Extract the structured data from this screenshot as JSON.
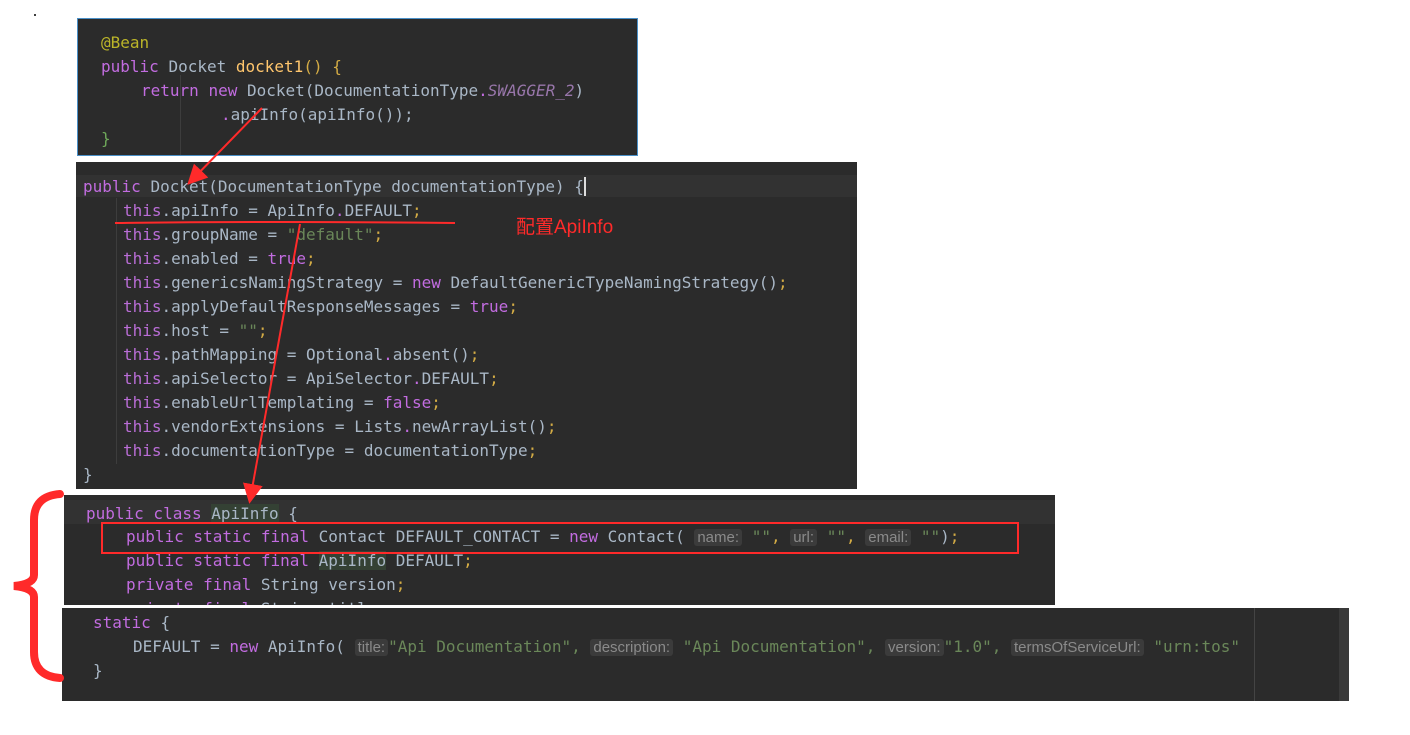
{
  "panel1": {
    "lines": [
      {
        "t": "@Bean",
        "c": "ann"
      },
      {
        "parts": [
          [
            "public ",
            "kw2"
          ],
          [
            "Docket ",
            ""
          ],
          [
            "docket1",
            "meth"
          ],
          [
            "() {",
            "paren"
          ]
        ]
      },
      {
        "parts": [
          [
            "return ",
            "kw2"
          ],
          [
            "new ",
            "kw2"
          ],
          [
            "Docket(DocumentationType",
            ""
          ],
          [
            ".",
            ""
          ],
          [
            "SWAGGER_2",
            "ital"
          ],
          [
            ")",
            ""
          ]
        ]
      },
      {
        "parts": [
          [
            ".apiInfo(apiInfo());",
            ""
          ]
        ]
      },
      {
        "t": "}",
        "c": "paren"
      }
    ]
  },
  "panel2": {
    "header": "public Docket(DocumentationType documentationType) {",
    "lines": [
      "this.apiInfo = ApiInfo.DEFAULT;",
      "this.groupName = \"default\";",
      "this.enabled = true;",
      "this.genericsNamingStrategy = new DefaultGenericTypeNamingStrategy();",
      "this.applyDefaultResponseMessages = true;",
      "this.host = \"\";",
      "this.pathMapping = Optional.absent();",
      "this.apiSelector = ApiSelector.DEFAULT;",
      "this.enableUrlTemplating = false;",
      "this.vendorExtensions = Lists.newArrayList();",
      "this.documentationType = documentationType;"
    ],
    "closing": "}"
  },
  "annotation": {
    "note": "配置ApiInfo"
  },
  "panel3": {
    "header": "public class ApiInfo {",
    "contact_line": {
      "prefix": "public static final Contact DEFAULT_CONTACT = new Contact(",
      "hint_name": "name:",
      "hint_url": "url:",
      "hint_email": "email:"
    },
    "line2": "public static final ApiInfo DEFAULT;",
    "line3": "private final String version;"
  },
  "panel4": {
    "line1": "static {",
    "line2_prefix": "DEFAULT = new ApiInfo(",
    "hint_title": "title:",
    "title_val": "\"Api Documentation\",",
    "hint_description": "description:",
    "description_val": "\"Api Documentation\",",
    "hint_version": "version:",
    "version_val": "\"1.0\",",
    "hint_tos": "termsOfServiceUrl:",
    "tos_val": "\"urn:tos\"",
    "line3": "}"
  },
  "colors": {
    "annotation_red": "#ff2a2a",
    "editor_bg": "#2b2b2b"
  }
}
